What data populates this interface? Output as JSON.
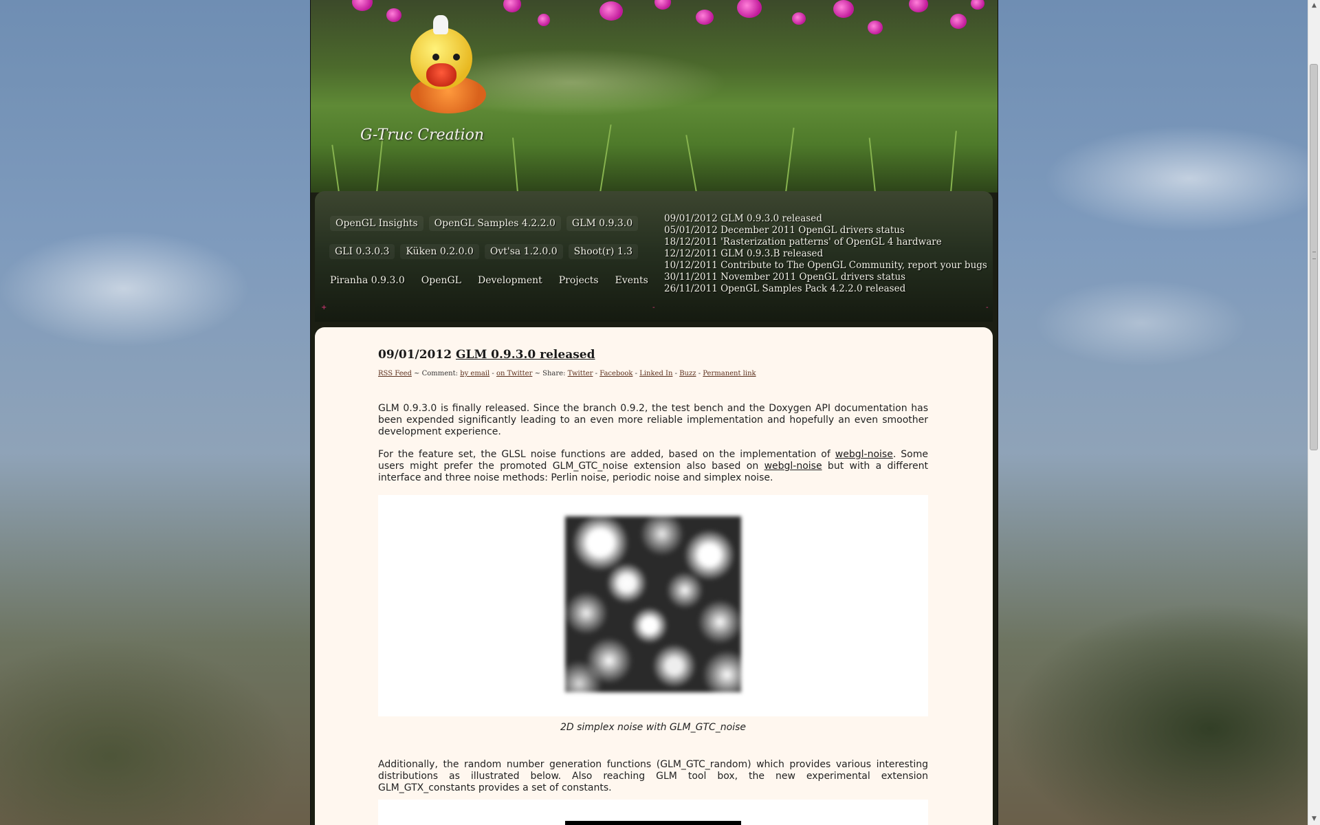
{
  "header": {
    "logo_text": "G-Truc Creation"
  },
  "nav": {
    "row1": [
      "OpenGL Insights",
      "OpenGL Samples 4.2.2.0",
      "GLM 0.9.3.0"
    ],
    "row2": [
      "GLI 0.3.0.3",
      "Küken 0.2.0.0",
      "Ovt'sa 1.2.0.0",
      "Shoot(r) 1.3"
    ],
    "row3": [
      "Piranha 0.9.3.0",
      "OpenGL",
      "Development",
      "Projects",
      "Events"
    ]
  },
  "news": [
    "09/01/2012 GLM 0.9.3.0 released",
    "05/01/2012 December 2011 OpenGL drivers status",
    "18/12/2011 'Rasterization patterns' of OpenGL 4 hardware",
    "12/12/2011 GLM 0.9.3.B released",
    "10/12/2011 Contribute to The OpenGL Community, report your bugs",
    "30/11/2011 November 2011 OpenGL drivers status",
    "26/11/2011 OpenGL Samples Pack 4.2.2.0 released"
  ],
  "post": {
    "date": "09/01/2012",
    "title": "GLM 0.9.3.0 released",
    "meta": {
      "rss": "RSS Feed",
      "sep1": " ~ Comment: ",
      "by_email": "by email",
      "dash": " - ",
      "on_twitter": "on Twitter",
      "sep2": " ~ Share: ",
      "twitter": "Twitter",
      "facebook": "Facebook",
      "linkedin": "Linked In",
      "buzz": "Buzz",
      "permalink": "Permanent link"
    },
    "p1": "GLM 0.9.3.0 is finally released. Since the branch 0.9.2, the test bench and the Doxygen API documentation has been expended significantly leading to an even more reliable implementation and hopefully an even smoother development experience.",
    "p2_a": "For the feature set, the GLSL noise functions are added, based on the implementation of ",
    "p2_link1": "webgl-noise",
    "p2_b": ". Some users might prefer the promoted GLM_GTC_noise extension also based on ",
    "p2_link2": "webgl-noise",
    "p2_c": " but with a different interface and three noise methods: Perlin noise, periodic noise and simplex noise.",
    "caption1": "2D simplex noise with GLM_GTC_noise",
    "p3": "Additionally, the random number generation functions (GLM_GTC_random) which provides various interesting distributions as illustrated below. Also reaching GLM tool box, the new experimental extension GLM_GTX_constants provides a set of constants."
  }
}
